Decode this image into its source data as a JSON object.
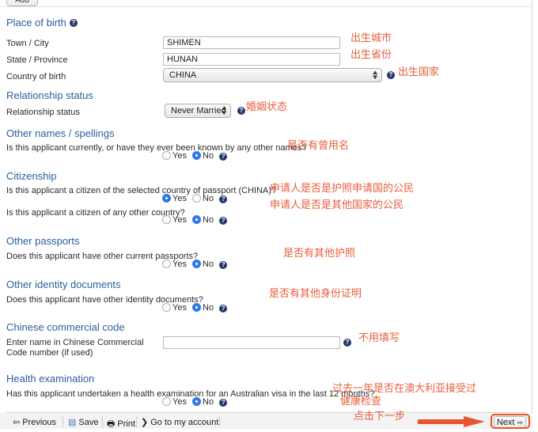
{
  "window": {
    "add_button_label": "Add"
  },
  "sections": [
    {
      "id": "place-of-birth",
      "heading": "Place of birth",
      "has_help": true,
      "fields": [
        {
          "label": "Town / City",
          "value": "SHIMEN",
          "type": "text"
        },
        {
          "label": "State / Province",
          "value": "HUNAN",
          "type": "text"
        },
        {
          "label": "Country of birth",
          "value": "CHINA",
          "type": "select",
          "has_help": true
        }
      ]
    },
    {
      "id": "relationship-status",
      "heading": "Relationship status",
      "has_help": false,
      "fields": [
        {
          "label": "Relationship status",
          "value": "Never Married",
          "type": "select",
          "has_help": true
        }
      ]
    },
    {
      "id": "other-names",
      "heading": "Other names / spellings",
      "has_help": false,
      "questions": [
        {
          "text": "Is this applicant currently, or have they ever been known by any other names?",
          "yes_label": "Yes",
          "no_label": "No",
          "selected": "No",
          "has_help": true
        }
      ]
    },
    {
      "id": "citizenship",
      "heading": "Citizenship",
      "has_help": false,
      "questions": [
        {
          "text": "Is this applicant a citizen of the selected country of passport (CHINA)?",
          "yes_label": "Yes",
          "no_label": "No",
          "selected": "Yes",
          "has_help": true
        },
        {
          "text": "Is this applicant a citizen of any other country?",
          "yes_label": "Yes",
          "no_label": "No",
          "selected": "No",
          "has_help": true
        }
      ]
    },
    {
      "id": "other-passports",
      "heading": "Other passports",
      "has_help": false,
      "questions": [
        {
          "text": "Does this applicant have other current passports?",
          "yes_label": "Yes",
          "no_label": "No",
          "selected": "No",
          "has_help": true
        }
      ]
    },
    {
      "id": "other-identity-documents",
      "heading": "Other identity documents",
      "has_help": false,
      "questions": [
        {
          "text": "Does this applicant have other identity documents?",
          "yes_label": "Yes",
          "no_label": "No",
          "selected": "No",
          "has_help": true
        }
      ]
    },
    {
      "id": "chinese-commercial-code",
      "heading": "Chinese commercial code",
      "has_help": false,
      "fields": [
        {
          "label": "Enter name in Chinese Commercial Code number (if used)",
          "value": "",
          "type": "text",
          "has_help": true
        }
      ]
    },
    {
      "id": "health-examination",
      "heading": "Health examination",
      "has_help": false,
      "questions": [
        {
          "text": "Has this applicant undertaken a health examination for an Australian visa in the last 12 months?",
          "yes_label": "Yes",
          "no_label": "No",
          "selected": "No",
          "has_help": true
        }
      ]
    }
  ],
  "annotations": [
    {
      "id": "ann-town",
      "text": "出生城市"
    },
    {
      "id": "ann-province",
      "text": "出生省份"
    },
    {
      "id": "ann-country",
      "text": "出生国家"
    },
    {
      "id": "ann-marital",
      "text": "婚姻状态"
    },
    {
      "id": "ann-other-names",
      "text": "是否有曾用名"
    },
    {
      "id": "ann-citizen-passport",
      "text": "申请人是否是护照申请国的公民"
    },
    {
      "id": "ann-citizen-other",
      "text": "申请人是否是其他国家的公民"
    },
    {
      "id": "ann-other-passports",
      "text": "是否有其他护照"
    },
    {
      "id": "ann-other-id",
      "text": "是否有其他身份证明"
    },
    {
      "id": "ann-ccc",
      "text": "不用填写"
    },
    {
      "id": "ann-health-1",
      "text": "过去一年是否在澳大利亚接受过"
    },
    {
      "id": "ann-health-2",
      "text": "健康检查"
    },
    {
      "id": "ann-next",
      "text": "点击下一步"
    }
  ],
  "footer": {
    "previous_label": "Previous",
    "save_label": "Save",
    "print_label": "Print",
    "account_label": "Go to my account",
    "next_label": "Next"
  },
  "colors": {
    "heading_blue": "#2c5f9e",
    "annotation_orange": "#ea5d3b",
    "radio_selected_blue": "#2f7ae5",
    "help_icon_navy": "#23386b"
  }
}
